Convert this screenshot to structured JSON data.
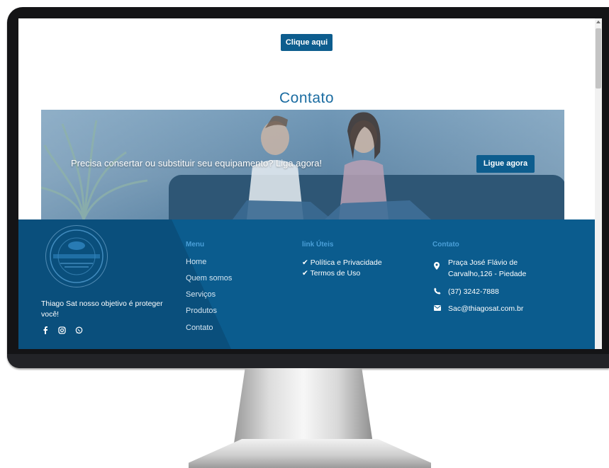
{
  "top_button": {
    "label": "Clique aqui"
  },
  "contato_section": {
    "title": "Contato",
    "banner_text": "Precisa consertar ou substituir seu equipamento? Liga agora!",
    "banner_button": "Ligue agora"
  },
  "footer": {
    "tagline": "Thiago Sat nosso objetivo é proteger você!",
    "social_icons": [
      "facebook-icon",
      "instagram-icon",
      "whatsapp-icon"
    ],
    "menu": {
      "title": "Menu",
      "items": [
        "Home",
        "Quem somos",
        "Serviços",
        "Produtos",
        "Contato"
      ]
    },
    "links": {
      "title": "link Úteis",
      "items": [
        "Política e Privacidade",
        "Termos de Uso"
      ]
    },
    "contact": {
      "title": "Contato",
      "address_line1": "Praça José Flávio de",
      "address_line2": "Carvalho,126 - Piedade",
      "phone": "(37) 3242-7888",
      "email": "Sac@thiagosat.com.br"
    }
  },
  "colors": {
    "primary_blue": "#0d5d8e",
    "footer_blue": "#0b5c8e",
    "title_blue": "#1b6ca1",
    "accent_blue": "#4a9fd8"
  }
}
